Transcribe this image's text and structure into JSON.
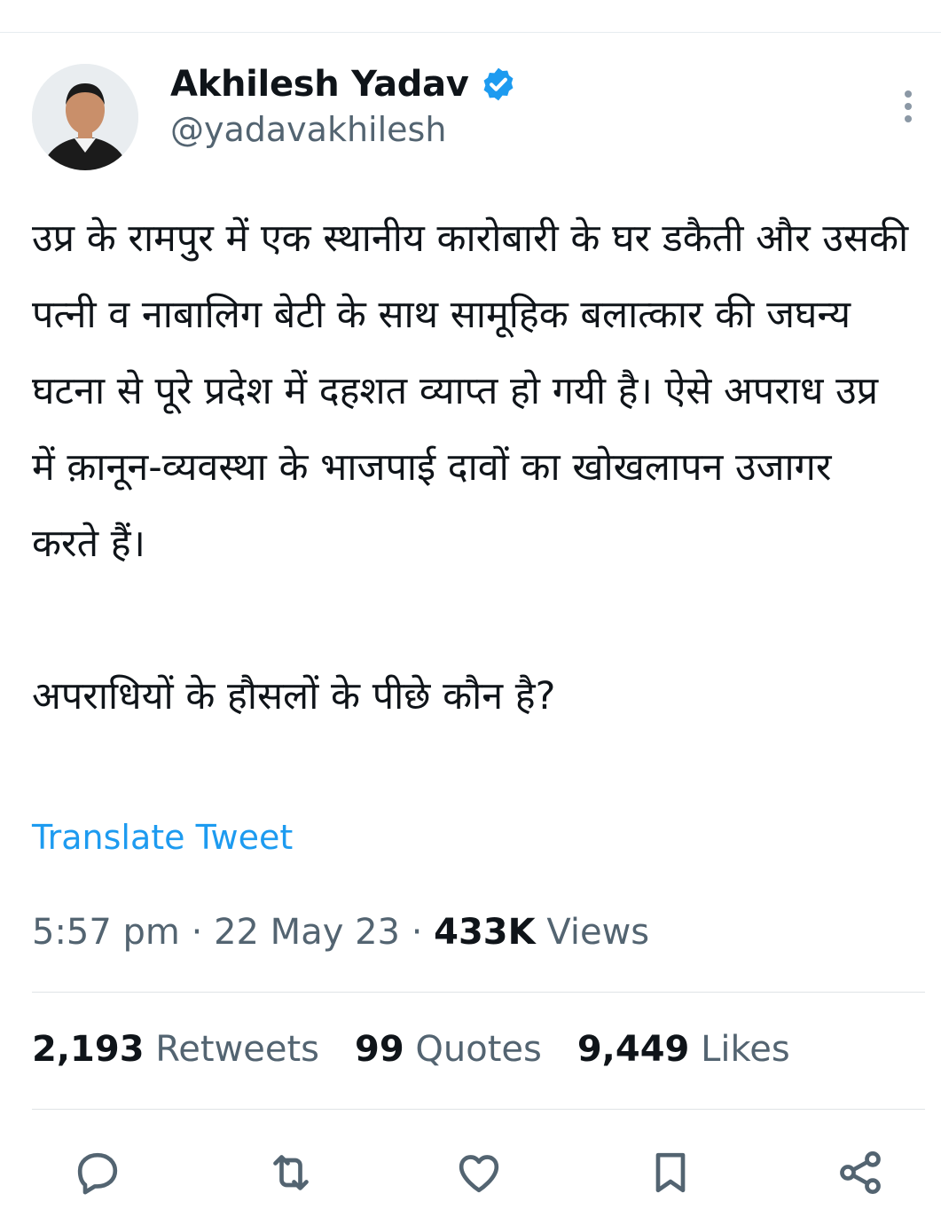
{
  "tweet": {
    "author_name": "Akhilesh Yadav",
    "handle": "@yadavakhilesh",
    "text": "उप्र के रामपुर में एक स्थानीय कारोबारी के घर डकैती और उसकी पत्नी व नाबालिग बेटी के साथ सामूहिक बलात्कार की जघन्य घटना से पूरे प्रदेश में दहशत व्याप्त हो गयी है। ऐसे अपराध उप्र में क़ानून-व्यवस्था के भाजपाई दावों का खोखलापन उजागर करते हैं।\n\nअपराधियों के हौसलों के पीछे कौन है?",
    "translate_label": "Translate Tweet",
    "time": "5:57 pm",
    "separator": "·",
    "date": "22 May 23",
    "views_count": "433K",
    "views_label": "Views"
  },
  "stats": {
    "retweets_count": "2,193",
    "retweets_label": "Retweets",
    "quotes_count": "99",
    "quotes_label": "Quotes",
    "likes_count": "9,449",
    "likes_label": "Likes"
  },
  "icons": {
    "verified": "verified-badge-icon",
    "more": "more-vertical-icon",
    "reply": "reply-icon",
    "retweet": "retweet-icon",
    "like": "heart-icon",
    "bookmark": "bookmark-icon",
    "share": "share-icon"
  },
  "colors": {
    "accent": "#1d9bf0",
    "secondary_text": "#536471",
    "primary_text": "#0f1419"
  }
}
